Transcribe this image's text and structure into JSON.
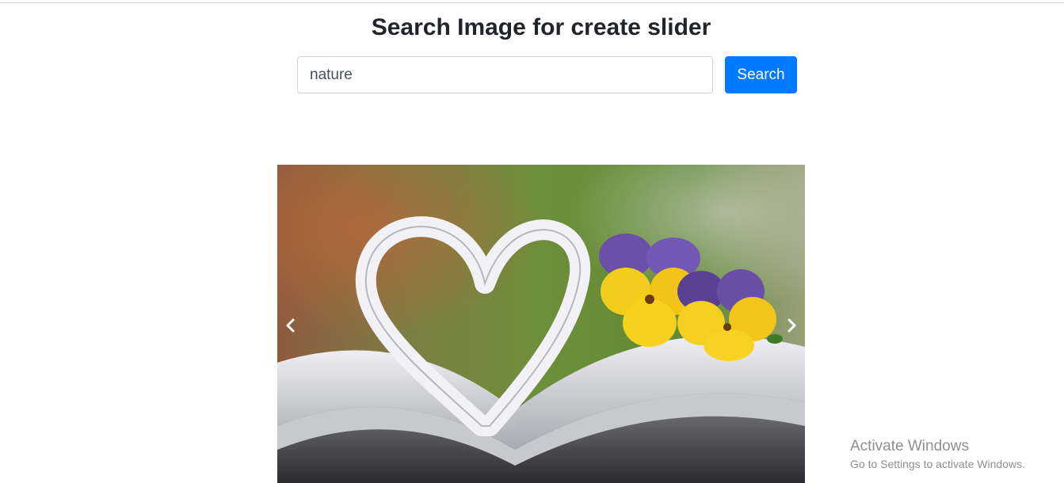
{
  "header": {
    "title": "Search Image for create slider"
  },
  "search": {
    "value": "nature",
    "button_label": "Search"
  },
  "slider": {
    "image_alt": "Open book with pages folded into a heart beside yellow and purple pansies",
    "prev_icon": "chevron-left-icon",
    "next_icon": "chevron-right-icon"
  },
  "os_watermark": {
    "title": "Activate Windows",
    "subtitle": "Go to Settings to activate Windows."
  },
  "colors": {
    "accent": "#007bff",
    "title_text": "#212529",
    "input_border": "#ced4da"
  }
}
